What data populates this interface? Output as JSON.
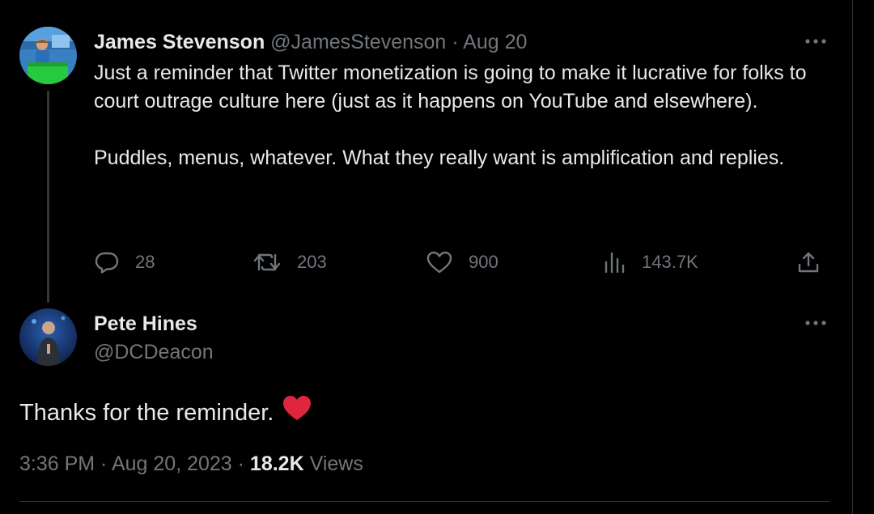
{
  "parent_tweet": {
    "author_name": "James Stevenson",
    "author_handle": "@JamesStevenson",
    "separator": " · ",
    "date": "Aug 20",
    "paragraphs": [
      "Just a reminder that Twitter monetization is going to make it lucrative for folks to court outrage culture here (just as it happens on YouTube and elsewhere).",
      "Puddles, menus, whatever. What they really want is amplification and replies."
    ],
    "actions": {
      "replies": "28",
      "retweets": "203",
      "likes": "900",
      "views": "143.7K"
    },
    "icons": [
      "reply-icon",
      "retweet-icon",
      "like-icon",
      "views-icon",
      "share-icon",
      "more-icon"
    ]
  },
  "main_tweet": {
    "author_name": "Pete Hines",
    "author_handle": "@DCDeacon",
    "text": "Thanks for the reminder.",
    "emoji": "heart",
    "time": "3:36 PM",
    "separator": " · ",
    "date": "Aug 20, 2023",
    "views_count": "18.2K",
    "views_label": "Views"
  },
  "colors": {
    "background": "#000000",
    "text": "#e7e9ea",
    "muted": "#71767b",
    "divider": "#2f3336",
    "heart": "#f91880"
  }
}
